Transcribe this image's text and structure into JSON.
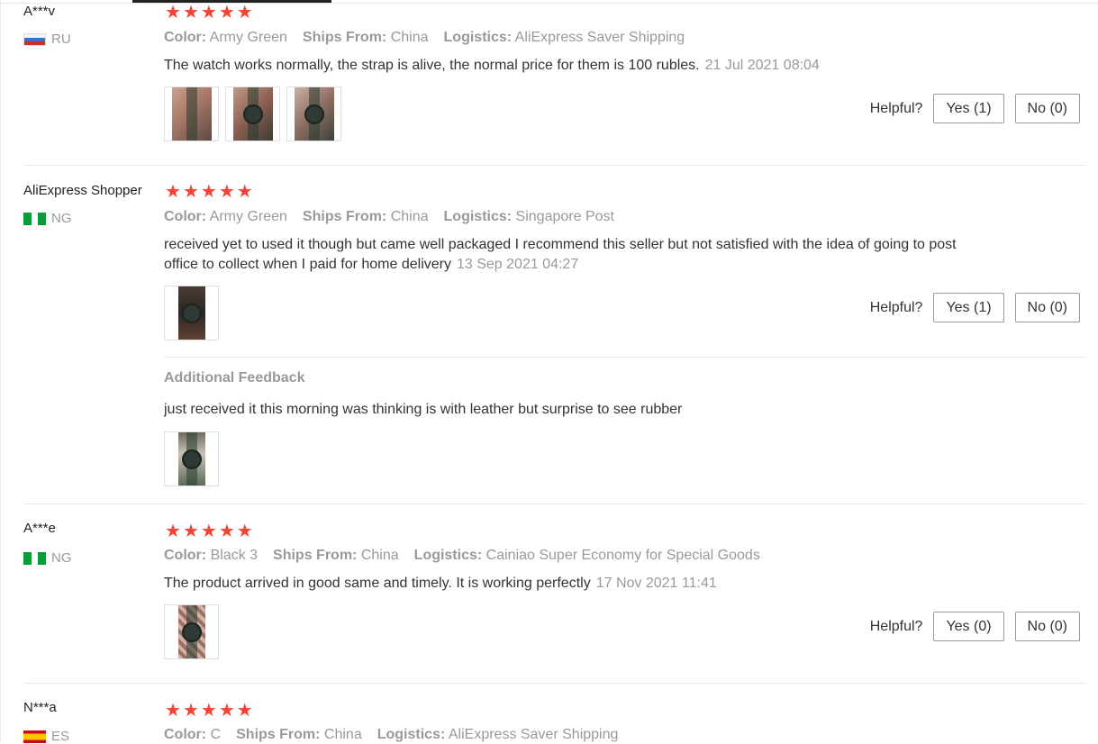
{
  "reviews": [
    {
      "user": "A***v",
      "country": "RU",
      "flag": "flag-ru",
      "stars": 5,
      "attrs": [
        {
          "label": "Color:",
          "value": "Army Green"
        },
        {
          "label": "Ships From:",
          "value": "China"
        },
        {
          "label": "Logistics:",
          "value": "AliExpress Saver Shipping"
        }
      ],
      "text": "The watch works normally, the strap is alive, the normal price for them is 100 rubles.",
      "date": "21 Jul 2021 08:04",
      "helpful": {
        "label": "Helpful?",
        "yes": "Yes (1)",
        "no": "No (0)"
      }
    },
    {
      "user": "AliExpress Shopper",
      "country": "NG",
      "flag": "flag-ng",
      "stars": 5,
      "attrs": [
        {
          "label": "Color:",
          "value": "Army Green"
        },
        {
          "label": "Ships From:",
          "value": "China"
        },
        {
          "label": "Logistics:",
          "value": "Singapore Post"
        }
      ],
      "text": "received yet to used it though but came well packaged I recommend this seller but not satisfied with the idea of going to post office to collect when I paid for home delivery",
      "date": "13 Sep 2021 04:27",
      "helpful": {
        "label": "Helpful?",
        "yes": "Yes (1)",
        "no": "No (0)"
      },
      "additional": {
        "title": "Additional Feedback",
        "text": "just received it this morning was thinking is with leather but surprise to see rubber"
      }
    },
    {
      "user": "A***e",
      "country": "NG",
      "flag": "flag-ng",
      "stars": 5,
      "attrs": [
        {
          "label": "Color:",
          "value": "Black 3"
        },
        {
          "label": "Ships From:",
          "value": "China"
        },
        {
          "label": "Logistics:",
          "value": "Cainiao Super Economy for Special Goods"
        }
      ],
      "text": "The product arrived in good same and timely. It is working perfectly",
      "date": "17 Nov 2021 11:41",
      "helpful": {
        "label": "Helpful?",
        "yes": "Yes (0)",
        "no": "No (0)"
      }
    },
    {
      "user": "N***a",
      "country": "ES",
      "flag": "flag-es",
      "stars": 5,
      "attrs": [
        {
          "label": "Color:",
          "value": "C"
        },
        {
          "label": "Ships From:",
          "value": "China"
        },
        {
          "label": "Logistics:",
          "value": "AliExpress Saver Shipping"
        }
      ]
    }
  ],
  "star_color": "#f44336",
  "star_glyph": "★"
}
